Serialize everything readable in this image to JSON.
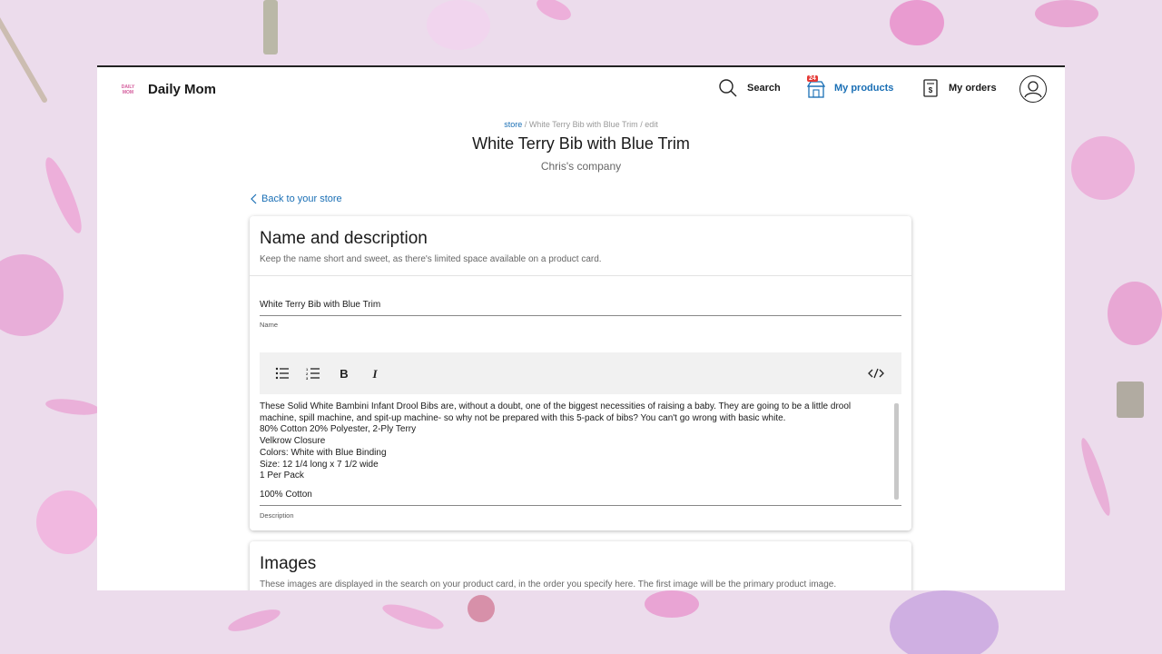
{
  "header": {
    "brand": "Daily Mom",
    "logo_text": "DAILY MOM",
    "nav": {
      "search": "Search",
      "products": "My products",
      "products_badge": "24",
      "orders": "My orders"
    }
  },
  "breadcrumb": {
    "store": "store",
    "sep1": "/",
    "product": "White Terry Bib with Blue Trim",
    "sep2": "/",
    "action": "edit"
  },
  "page": {
    "title": "White Terry Bib with Blue Trim",
    "company": "Chris's company",
    "back_link": "Back to your store"
  },
  "name_section": {
    "title": "Name and description",
    "subtitle": "Keep the name short and sweet, as there's limited space available on a product card.",
    "name_value": "White Terry Bib with Blue Trim",
    "name_label": "Name",
    "description_lines": [
      "These Solid White Bambini Infant Drool Bibs are, without a doubt, one of the biggest necessities of raising a baby. They are going to be a little drool machine, spill machine, and spit-up machine- so why not be prepared with this 5-pack of bibs? You can't go wrong with basic white.",
      "80% Cotton 20% Polyester, 2-Ply Terry",
      "Velkrow Closure",
      "Colors: White with Blue Binding",
      "Size: 12 1/4 long x 7 1/2 wide",
      "1 Per Pack"
    ],
    "description_last": "100% Cotton",
    "description_label": "Description"
  },
  "images_section": {
    "title": "Images",
    "subtitle": "These images are displayed in the search on your product card, in the order you specify here. The first image will be the primary product image."
  },
  "toolbar_icons": [
    "bullet-list-icon",
    "numbered-list-icon",
    "bold-icon",
    "italic-icon",
    "code-icon"
  ],
  "colors": {
    "accent": "#1a6fb5",
    "badge": "#e53935",
    "background": "#ecdcec"
  }
}
